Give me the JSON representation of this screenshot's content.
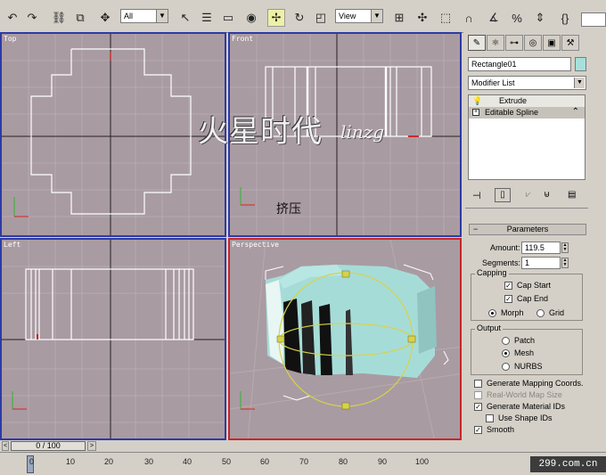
{
  "toolbar": {
    "selection_filter": "All",
    "coord_system": "View"
  },
  "viewports": {
    "top": "Top",
    "front": "Front",
    "left": "Left",
    "perspective": "Perspective"
  },
  "overlay": {
    "watermark_cn": "火星时代",
    "watermark_en": "linzg",
    "note_cn": "挤压"
  },
  "command_panel": {
    "object_name": "Rectangle01",
    "object_color": "#a6e0dc",
    "modifier_list": "Modifier List",
    "stack": [
      "Extrude",
      "Editable Spline"
    ],
    "rollout_title": "Parameters",
    "amount_label": "Amount:",
    "amount_value": "119.5",
    "segments_label": "Segments:",
    "segments_value": "1",
    "capping_title": "Capping",
    "cap_start": "Cap Start",
    "cap_end": "Cap End",
    "morph": "Morph",
    "grid": "Grid",
    "output_title": "Output",
    "patch": "Patch",
    "mesh": "Mesh",
    "nurbs": "NURBS",
    "gen_mapping": "Generate Mapping Coords.",
    "real_world": "Real-World Map Size",
    "gen_material": "Generate Material IDs",
    "use_shape": "Use Shape IDs",
    "smooth": "Smooth"
  },
  "timeline": {
    "frame": "0 / 100",
    "ticks": [
      "0",
      "10",
      "20",
      "30",
      "40",
      "50",
      "60",
      "70",
      "80",
      "90",
      "100"
    ]
  },
  "site": "299.com.cn",
  "colors": {
    "viewport_bg": "#a99ba2",
    "active_border": "#c8262a",
    "box": "#a6dcd8"
  }
}
